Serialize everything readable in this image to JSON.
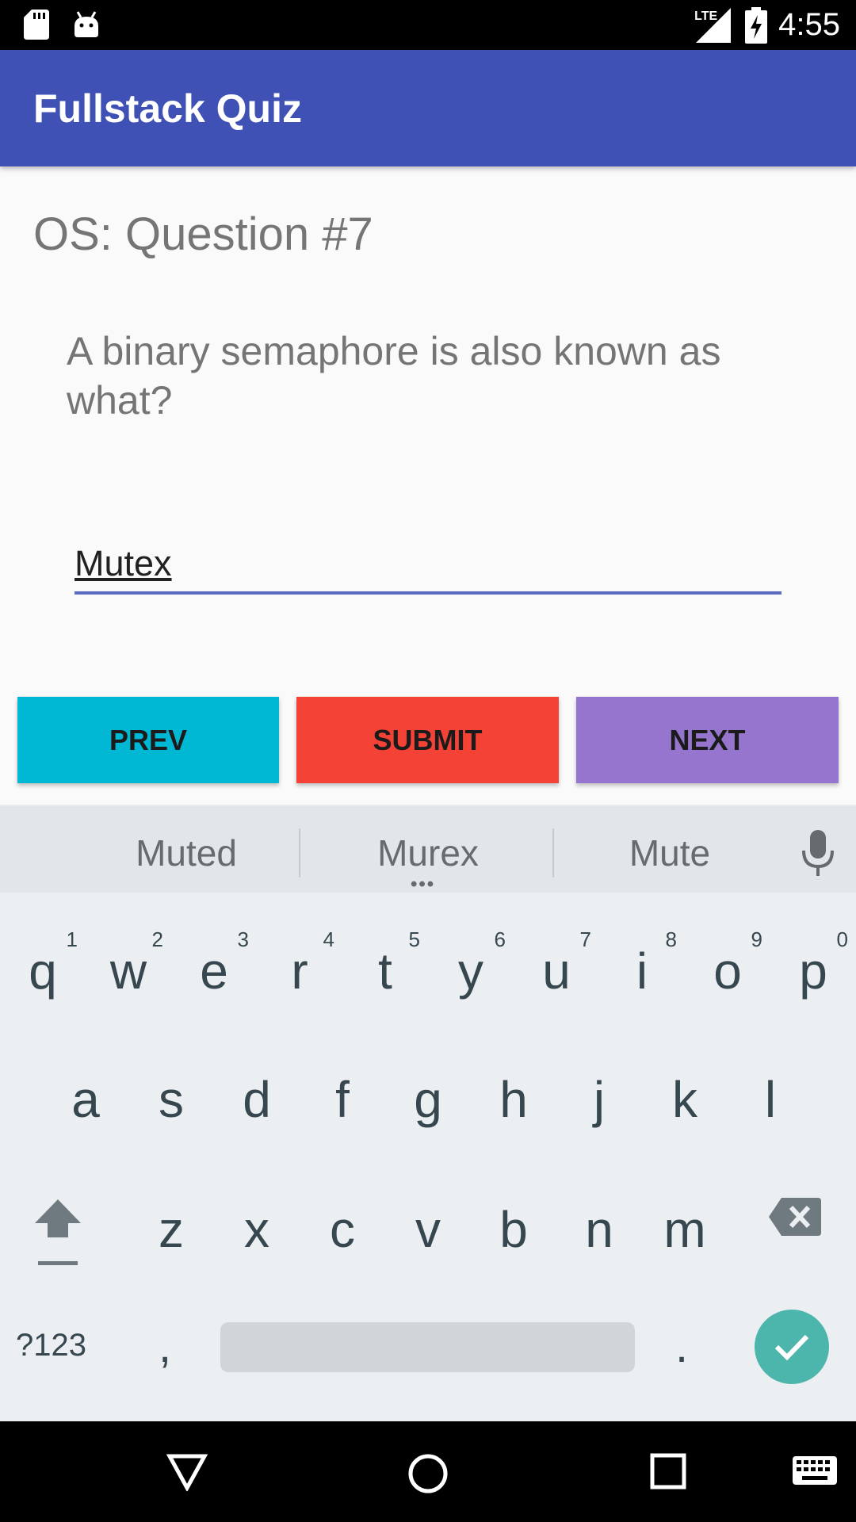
{
  "status_bar": {
    "time": "4:55",
    "network": "LTE",
    "icons": [
      "sd-card-icon",
      "android-icon",
      "lte-signal-icon",
      "battery-charging-icon"
    ]
  },
  "app_bar": {
    "title": "Fullstack Quiz",
    "color": "#3f51b5"
  },
  "quiz": {
    "heading": "OS: Question #7",
    "question": "A binary semaphore is also known as what?",
    "answer_value": "Mutex"
  },
  "buttons": {
    "prev": "PREV",
    "submit": "SUBMIT",
    "next": "NEXT",
    "colors": {
      "prev": "#00b8d4",
      "submit": "#f44336",
      "next": "#9575cd"
    }
  },
  "keyboard": {
    "suggestions": [
      "Muted",
      "Murex",
      "Mute"
    ],
    "row1": [
      {
        "ch": "q",
        "hint": "1"
      },
      {
        "ch": "w",
        "hint": "2"
      },
      {
        "ch": "e",
        "hint": "3"
      },
      {
        "ch": "r",
        "hint": "4"
      },
      {
        "ch": "t",
        "hint": "5"
      },
      {
        "ch": "y",
        "hint": "6"
      },
      {
        "ch": "u",
        "hint": "7"
      },
      {
        "ch": "i",
        "hint": "8"
      },
      {
        "ch": "o",
        "hint": "9"
      },
      {
        "ch": "p",
        "hint": "0"
      }
    ],
    "row2": [
      "a",
      "s",
      "d",
      "f",
      "g",
      "h",
      "j",
      "k",
      "l"
    ],
    "row3": [
      "z",
      "x",
      "c",
      "v",
      "b",
      "n",
      "m"
    ],
    "symbols_label": "?123",
    "comma": ",",
    "period": ".",
    "enter_color": "#4db6ac"
  },
  "nav_bar": {
    "icons": [
      "back-icon",
      "home-icon",
      "recents-icon",
      "keyboard-switch-icon"
    ]
  }
}
